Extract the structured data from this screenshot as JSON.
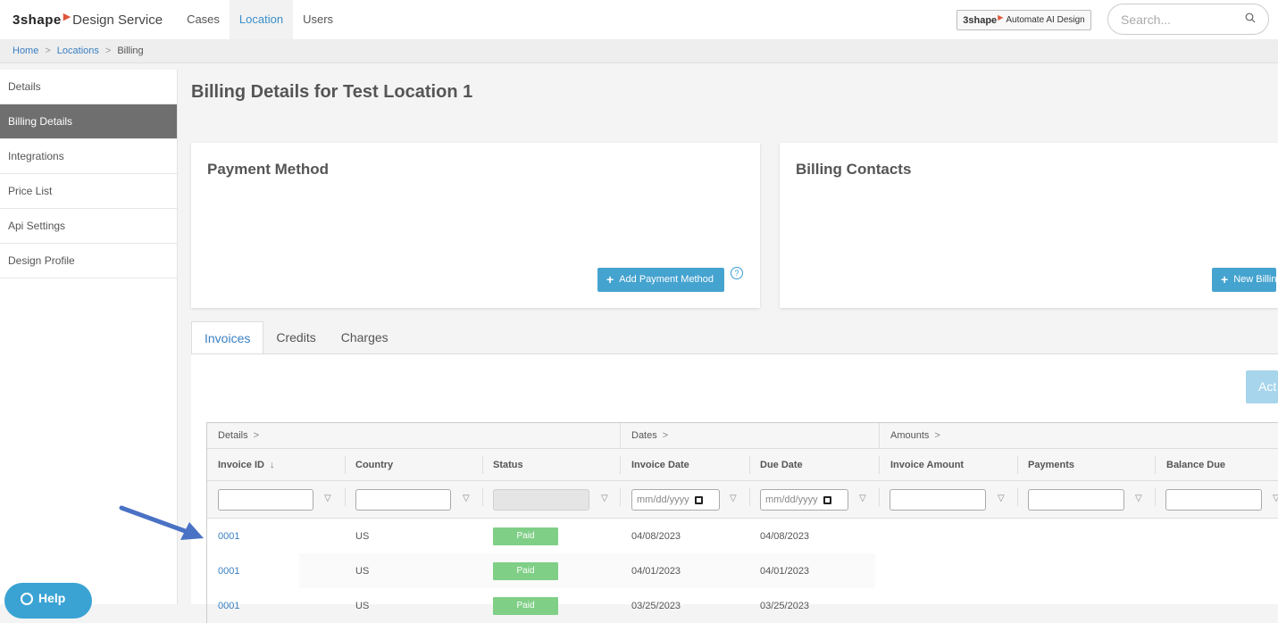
{
  "topbar": {
    "brand_logo": "3shape",
    "brand_mark": "▶",
    "brand_name": "Design Service",
    "nav": [
      {
        "label": "Cases",
        "active": false
      },
      {
        "label": "Location",
        "active": true
      },
      {
        "label": "Users",
        "active": false
      }
    ],
    "ai_badge": {
      "logo": "3shape",
      "mark": "▶",
      "text": "Automate AI Design"
    },
    "search": {
      "placeholder": "Search..."
    }
  },
  "breadcrumb": {
    "items": [
      "Home",
      "Locations"
    ],
    "separator": ">",
    "current": "Billing"
  },
  "sidebar": {
    "items": [
      {
        "label": "Details",
        "active": false
      },
      {
        "label": "Billing Details",
        "active": true
      },
      {
        "label": "Integrations",
        "active": false
      },
      {
        "label": "Price List",
        "active": false
      },
      {
        "label": "Api Settings",
        "active": false
      },
      {
        "label": "Design Profile",
        "active": false
      }
    ]
  },
  "page": {
    "title": "Billing Details for Test Location 1"
  },
  "payment_card": {
    "title": "Payment Method",
    "button": "Add Payment Method",
    "help": "?"
  },
  "contacts_card": {
    "title": "Billing Contacts",
    "button": "New Billin"
  },
  "tabs": [
    {
      "label": "Invoices",
      "active": true
    },
    {
      "label": "Credits",
      "active": false
    },
    {
      "label": "Charges",
      "active": false
    }
  ],
  "actions_button": "Act",
  "grid": {
    "groups": [
      "Details",
      "Dates",
      "Amounts"
    ],
    "group_chevron": ">",
    "sort_arrow": "↓",
    "columns": [
      "Invoice ID",
      "Country",
      "Status",
      "Invoice Date",
      "Due Date",
      "Invoice Amount",
      "Payments",
      "Balance Due"
    ],
    "date_placeholder": "mm/dd/yyyy",
    "rows": [
      {
        "invoice_id": "0001",
        "country": "US",
        "status": "Paid",
        "invoice_date": "04/08/2023",
        "due_date": "04/08/2023"
      },
      {
        "invoice_id": "0001",
        "country": "US",
        "status": "Paid",
        "invoice_date": "04/01/2023",
        "due_date": "04/01/2023"
      },
      {
        "invoice_id": "0001",
        "country": "US",
        "status": "Paid",
        "invoice_date": "03/25/2023",
        "due_date": "03/25/2023"
      }
    ]
  },
  "help_button": "Help",
  "colors": {
    "accent": "#3a7fc2",
    "button": "#45a3cf",
    "sidebar_active": "#6f6f6f",
    "paid": "#7fcf86",
    "brand": "#e0563b"
  }
}
